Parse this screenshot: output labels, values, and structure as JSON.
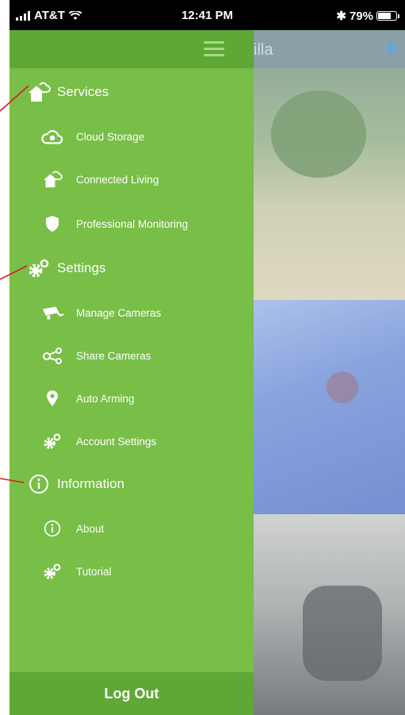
{
  "status": {
    "carrier": "AT&T",
    "time": "12:41 PM",
    "battery": "79%",
    "battery_level": 0.79
  },
  "background": {
    "brand_partial": "illa",
    "add_symbol": "+"
  },
  "menu": {
    "sections": [
      {
        "label": "Services",
        "icon": "house-cloud-icon",
        "items": [
          {
            "label": "Cloud Storage",
            "icon": "cloud-icon"
          },
          {
            "label": "Connected Living",
            "icon": "house-cloud-icon"
          },
          {
            "label": "Professional Monitoring",
            "icon": "shield-icon"
          }
        ]
      },
      {
        "label": "Settings",
        "icon": "gears-icon",
        "items": [
          {
            "label": "Manage Cameras",
            "icon": "camera-icon"
          },
          {
            "label": "Share Cameras",
            "icon": "share-icon"
          },
          {
            "label": "Auto Arming",
            "icon": "location-pin-icon"
          },
          {
            "label": "Account Settings",
            "icon": "gears-icon"
          }
        ]
      },
      {
        "label": "Information",
        "icon": "info-icon",
        "items": [
          {
            "label": "About",
            "icon": "info-icon"
          },
          {
            "label": "Tutorial",
            "icon": "gears-icon"
          }
        ]
      }
    ],
    "logout_label": "Log Out"
  },
  "colors": {
    "drawer": "#78be47",
    "drawer_header": "#5fa835",
    "annotation": "#d42020"
  }
}
